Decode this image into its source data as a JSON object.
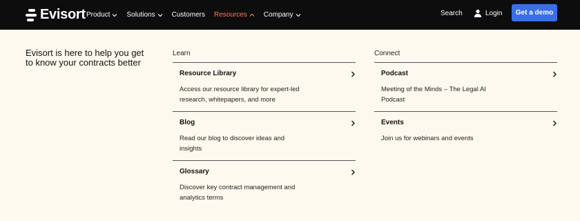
{
  "header": {
    "logo_text": "Evisort",
    "nav": [
      {
        "label": "Product"
      },
      {
        "label": "Solutions"
      },
      {
        "label": "Customers"
      },
      {
        "label": "Resources"
      },
      {
        "label": "Company"
      }
    ],
    "search_label": "Search",
    "login_label": "Login",
    "demo_label": "Get a demo"
  },
  "intro": "Evisort is here to help you get to know your contracts better",
  "learn": {
    "title": "Learn",
    "cards": [
      {
        "title": "Resource Library",
        "desc": "Access our resource library for expert-led research, whitepapers, and more"
      },
      {
        "title": "Blog",
        "desc": "Read our blog to discover ideas and insights"
      },
      {
        "title": "Glossary",
        "desc": "Discover key contract management and analytics terms"
      }
    ]
  },
  "connect": {
    "title": "Connect",
    "cards": [
      {
        "title": "Podcast",
        "desc": "Meeting of the Minds – The Legal AI Podcast"
      },
      {
        "title": "Events",
        "desc": "Join us for webinars and events"
      }
    ]
  },
  "colors": {
    "accent": "#ff7a5c",
    "button": "#3a6fe6",
    "bar": "#0d0d0d",
    "page": "#fdf9ee"
  }
}
